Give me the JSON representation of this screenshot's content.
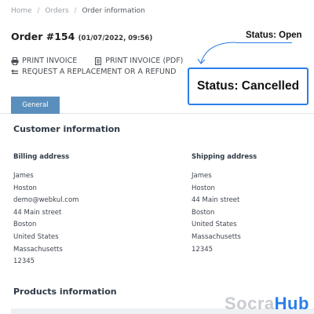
{
  "breadcrumb": {
    "items": [
      "Home",
      "Orders",
      "Order information"
    ],
    "separator": "/"
  },
  "order": {
    "title": "Order #154",
    "date": "(01/07/2022, 09:56)"
  },
  "actions": {
    "print_invoice": "PRINT INVOICE",
    "print_invoice_pdf": "PRINT INVOICE (PDF)",
    "request": "REQUEST A REPLACEMENT OR A REFUND"
  },
  "annotations": {
    "status_open": "Status: Open",
    "status_cancelled": "Status: Cancelled",
    "accent_color": "#2b7de9"
  },
  "tabs": {
    "general": "General"
  },
  "customer": {
    "title": "Customer information",
    "billing": {
      "heading": "Billing address",
      "lines": [
        "James",
        "Hoston",
        "demo@webkul.com",
        "44 Main street",
        "Boston",
        "United States",
        "Massachusetts",
        "12345"
      ]
    },
    "shipping": {
      "heading": "Shipping address",
      "lines": [
        "James",
        "Hoston",
        "44 Main street",
        "Boston",
        "United States",
        "Massachusetts",
        "12345"
      ]
    }
  },
  "products": {
    "title": "Products information"
  },
  "watermark": {
    "part1": "Socra",
    "part2": "Hub"
  },
  "icons": {
    "print": "printer-icon",
    "pdf": "pdf-icon",
    "refund": "return-icon"
  }
}
